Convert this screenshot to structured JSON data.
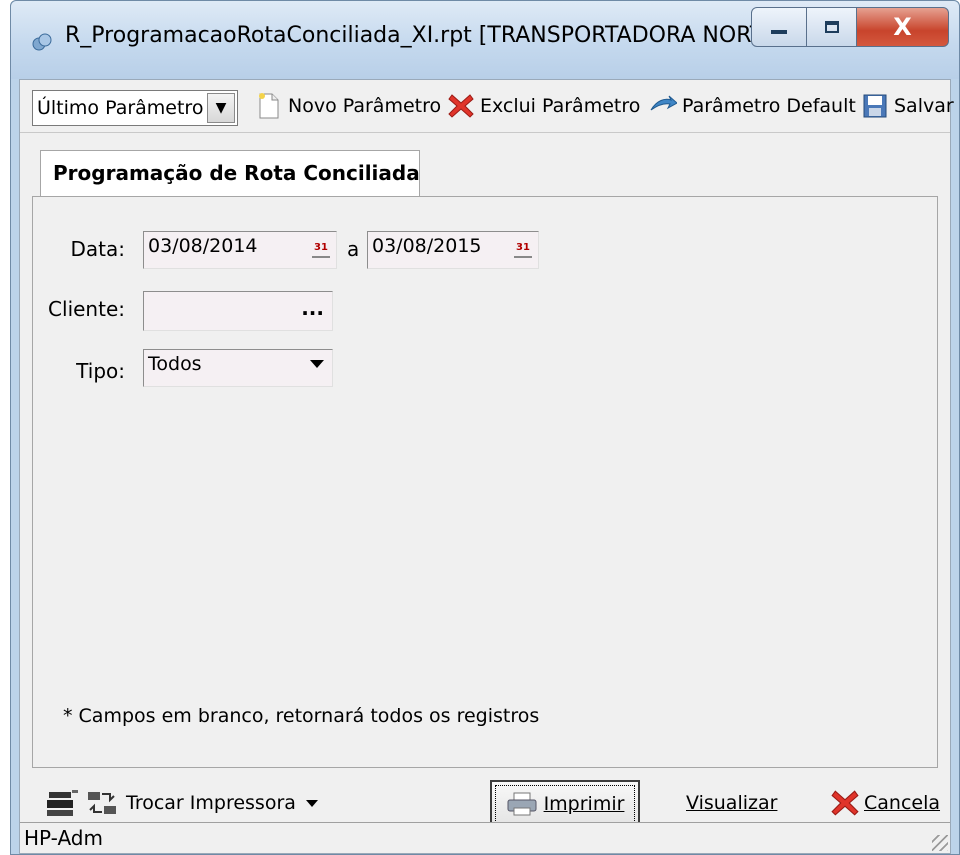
{
  "window": {
    "title": "R_ProgramacaoRotaConciliada_XI.rpt [TRANSPORTADORA NORTE ...",
    "close_glyph": "X"
  },
  "toolbar": {
    "param_select": "Último Parâmetro",
    "new_param": "Novo Parâmetro",
    "delete_param": "Exclui Parâmetro",
    "default_param": "Parâmetro Default",
    "save": "Salvar"
  },
  "tab": {
    "label": "Programação de Rota Conciliada"
  },
  "form": {
    "date_label": "Data:",
    "date_from": "03/08/2014",
    "date_separator": "a",
    "date_to": "03/08/2015",
    "client_label": "Cliente:",
    "client_value": "",
    "client_button": "...",
    "type_label": "Tipo:",
    "type_value": "Todos",
    "calendar_glyph": "31"
  },
  "note": "* Campos em branco, retornará todos os registros",
  "bottom": {
    "change_printer": "Trocar Impressora",
    "print": "Imprimir",
    "preview": "Visualizar",
    "cancel": "Cancela"
  },
  "status": {
    "printer": "HP-Adm"
  },
  "colors": {
    "titlebar": "#c5d9ee",
    "close_button": "#c8442c",
    "field_bg": "#f5f0f3",
    "dialog_bg": "#f0f0f0"
  }
}
